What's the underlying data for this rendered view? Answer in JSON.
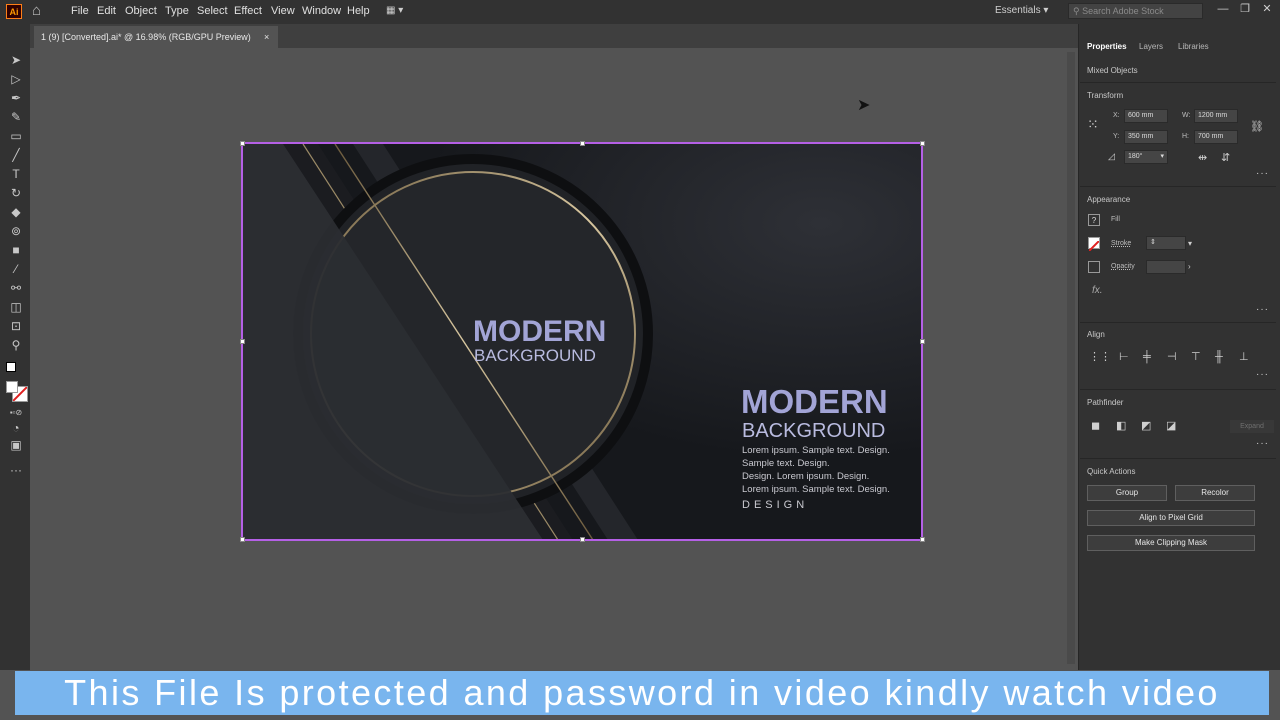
{
  "app": {
    "logo": "Ai"
  },
  "menu": [
    "File",
    "Edit",
    "Object",
    "Type",
    "Select",
    "Effect",
    "View",
    "Window",
    "Help"
  ],
  "workspace": "Essentials",
  "search_placeholder": "Search Adobe Stock",
  "document_tab": {
    "title": "1 (9) [Converted].ai* @ 16.98% (RGB/GPU Preview)",
    "close": "×"
  },
  "panel": {
    "tabs": [
      "Properties",
      "Layers",
      "Libraries"
    ],
    "selection": "Mixed Objects",
    "transform": {
      "title": "Transform",
      "x_label": "X:",
      "x": "600 mm",
      "y_label": "Y:",
      "y": "350 mm",
      "w_label": "W:",
      "w": "1200 mm",
      "h_label": "H:",
      "h": "700 mm",
      "angle": "180°"
    },
    "appearance": {
      "title": "Appearance",
      "fill": "Fill",
      "stroke": "Stroke",
      "opacity": "Opacity",
      "fx": "fx."
    },
    "align": {
      "title": "Align"
    },
    "pathfinder": {
      "title": "Pathfinder",
      "expand": "Expand"
    },
    "quick_actions": {
      "title": "Quick Actions",
      "group": "Group",
      "recolor": "Recolor",
      "align_pixel": "Align to Pixel Grid",
      "clipping": "Make Clipping Mask"
    }
  },
  "artwork": {
    "center_title": "MODERN",
    "center_subtitle": "BACKGROUND",
    "right_title": "MODERN",
    "right_subtitle": "BACKGROUND",
    "lines": [
      "Lorem ipsum. Sample text. Design.",
      "Sample text. Design.",
      "Design. Lorem ipsum. Design.",
      "Lorem ipsum. Sample text. Design."
    ],
    "tagline": "DESIGN"
  },
  "banner": "This File Is protected and password in video kindly watch video",
  "colors": {
    "selection": "#b560e6",
    "banner": "#79b5ee",
    "title_text": "#a2a4d6"
  }
}
